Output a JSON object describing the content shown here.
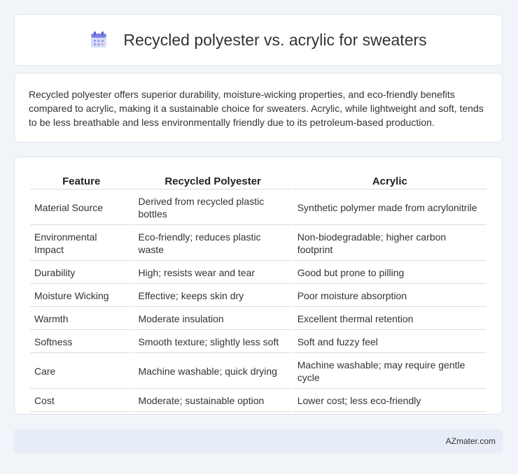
{
  "header": {
    "title": "Recycled polyester vs. acrylic for sweaters",
    "icon": "calendar-icon"
  },
  "intro": {
    "text": "Recycled polyester offers superior durability, moisture-wicking properties, and eco-friendly benefits compared to acrylic, making it a sustainable choice for sweaters. Acrylic, while lightweight and soft, tends to be less breathable and less environmentally friendly due to its petroleum-based production."
  },
  "table": {
    "headers": [
      "Feature",
      "Recycled Polyester",
      "Acrylic"
    ],
    "rows": [
      [
        "Material Source",
        "Derived from recycled plastic bottles",
        "Synthetic polymer made from acrylonitrile"
      ],
      [
        "Environmental Impact",
        "Eco-friendly; reduces plastic waste",
        "Non-biodegradable; higher carbon footprint"
      ],
      [
        "Durability",
        "High; resists wear and tear",
        "Good but prone to pilling"
      ],
      [
        "Moisture Wicking",
        "Effective; keeps skin dry",
        "Poor moisture absorption"
      ],
      [
        "Warmth",
        "Moderate insulation",
        "Excellent thermal retention"
      ],
      [
        "Softness",
        "Smooth texture; slightly less soft",
        "Soft and fuzzy feel"
      ],
      [
        "Care",
        "Machine washable; quick drying",
        "Machine washable; may require gentle cycle"
      ],
      [
        "Cost",
        "Moderate; sustainable option",
        "Lower cost; less eco-friendly"
      ]
    ]
  },
  "footer": {
    "brand": "AZmater.com"
  }
}
